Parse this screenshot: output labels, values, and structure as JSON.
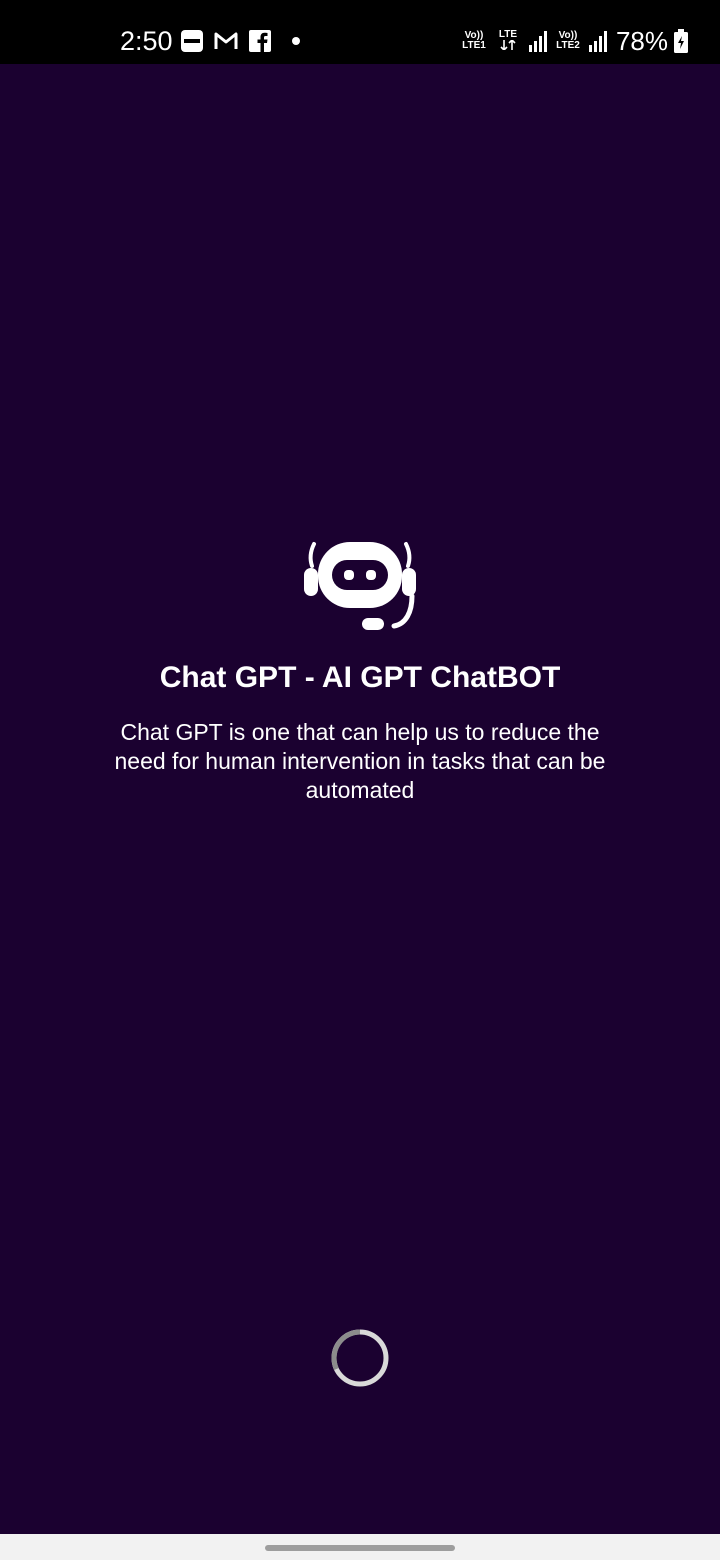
{
  "status_bar": {
    "time": "2:50",
    "notification_icons": [
      "paytm-icon",
      "gmail-icon",
      "facebook-icon",
      "dot-icon"
    ],
    "sim1_label_top": "Vo))",
    "sim1_label_bottom": "LTE1",
    "data_label": "LTE",
    "sim2_label_top": "Vo))",
    "sim2_label_bottom": "LTE2",
    "battery": "78%"
  },
  "splash": {
    "logo_icon": "robot-headset-icon",
    "title": "Chat GPT - AI GPT ChatBOT",
    "description": "Chat GPT is one that can help us to reduce the need for human intervention in tasks that can be automated",
    "loading_indicator": "spinner-icon"
  },
  "colors": {
    "background": "#1b0130",
    "status_bar": "#000000",
    "text": "#ffffff",
    "nav_bar": "#f2f2f2"
  }
}
